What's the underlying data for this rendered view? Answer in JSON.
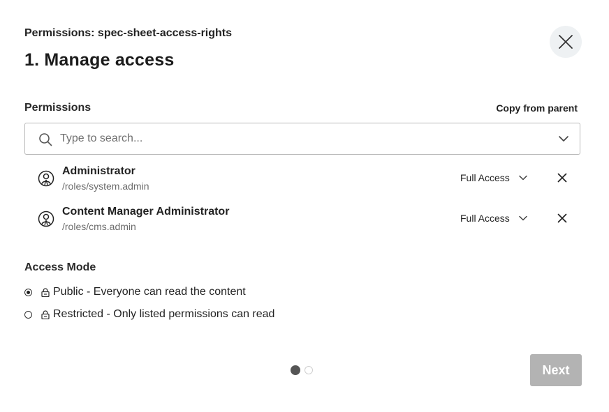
{
  "dialog": {
    "subtitle": "Permissions: spec-sheet-access-rights",
    "title": "1. Manage access",
    "close_icon": "close-icon"
  },
  "permissions": {
    "label": "Permissions",
    "copy_from_parent": "Copy from parent",
    "search": {
      "placeholder": "Type to search...",
      "value": ""
    },
    "rows": [
      {
        "name": "Administrator",
        "path": "/roles/system.admin",
        "access": "Full Access",
        "icon": "role-icon"
      },
      {
        "name": "Content Manager Administrator",
        "path": "/roles/cms.admin",
        "access": "Full Access",
        "icon": "role-icon"
      }
    ]
  },
  "access_mode": {
    "label": "Access Mode",
    "options": [
      {
        "label": "Public - Everyone can read the content",
        "checked": true,
        "icon": "lock-icon"
      },
      {
        "label": "Restricted - Only listed permissions can read",
        "checked": false,
        "icon": "lock-icon"
      }
    ]
  },
  "stepper": {
    "current_step": 1,
    "total_steps": 2
  },
  "footer": {
    "next_label": "Next",
    "next_enabled": false
  },
  "colors": {
    "next_disabled_bg": "#b3b3b3",
    "close_bg": "#eef1f3"
  }
}
